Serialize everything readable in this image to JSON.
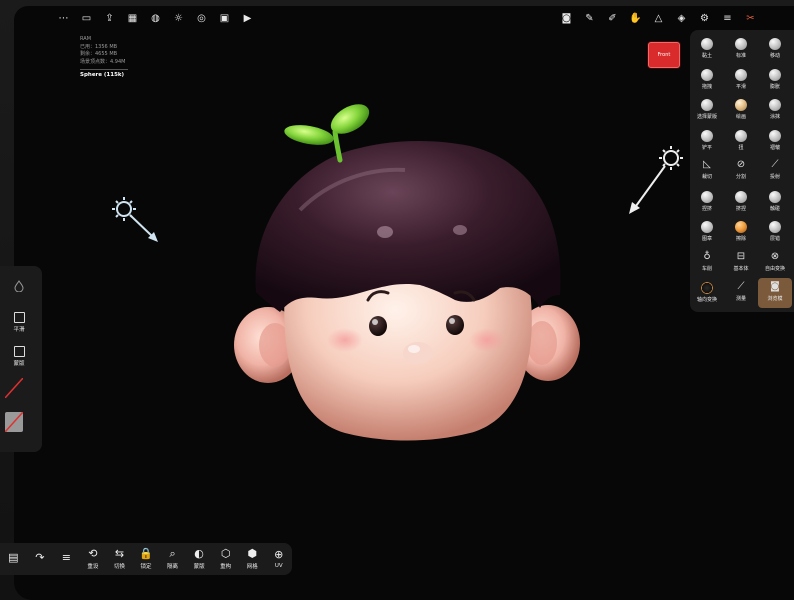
{
  "stats": {
    "ram_heading": "RAM",
    "line1": "已用：1356 MB",
    "line2": "剩余：4655 MB",
    "line3": "场景顶点数：4.94M",
    "object_name": "Sphere (115k)"
  },
  "front_button": "Front",
  "top_left_icons": [
    "scene-icon",
    "folder-icon",
    "share-icon",
    "grid-icon",
    "sphere-icon",
    "sun-icon",
    "target-icon",
    "image-icon",
    "video-icon"
  ],
  "top_right_icons": [
    "camera-icon",
    "brush-icon",
    "pen-icon",
    "hand-icon",
    "triangle-icon",
    "layers-icon",
    "settings-icon",
    "menu-icon",
    "tools-icon"
  ],
  "tools": [
    {
      "label": "黏土",
      "icon": "clay-icon"
    },
    {
      "label": "标准",
      "icon": "standard-icon"
    },
    {
      "label": "移动",
      "icon": "move-icon"
    },
    {
      "label": "拖拽",
      "icon": "drag-icon"
    },
    {
      "label": "平滑",
      "icon": "smooth-icon"
    },
    {
      "label": "膨胀",
      "icon": "inflate-icon"
    },
    {
      "label": "选择蒙版",
      "icon": "select-mask-icon"
    },
    {
      "label": "绘画",
      "icon": "paint-icon"
    },
    {
      "label": "涂抹",
      "icon": "smudge-icon"
    },
    {
      "label": "铲平",
      "icon": "flatten-icon"
    },
    {
      "label": "扭",
      "icon": "twist-icon"
    },
    {
      "label": "褶皱",
      "icon": "crease-icon"
    },
    {
      "label": "裁切",
      "icon": "trim-icon"
    },
    {
      "label": "分割",
      "icon": "split-icon"
    },
    {
      "label": "投射",
      "icon": "project-icon"
    },
    {
      "label": "捏挤",
      "icon": "pinch-icon"
    },
    {
      "label": "挤捏",
      "icon": "nudge-icon"
    },
    {
      "label": "触碰",
      "icon": "touch-icon"
    },
    {
      "label": "图章",
      "icon": "stamp-icon"
    },
    {
      "label": "擦除",
      "icon": "erase-icon"
    },
    {
      "label": "层错",
      "icon": "layer-icon"
    },
    {
      "label": "车削",
      "icon": "lathe-icon"
    },
    {
      "label": "基本体",
      "icon": "primitive-icon"
    },
    {
      "label": "自由变换",
      "icon": "free-transform-icon"
    },
    {
      "label": "轴向变换",
      "icon": "gizmo-icon"
    },
    {
      "label": "测量",
      "icon": "measure-icon"
    },
    {
      "label": "浏览模",
      "icon": "view-icon"
    }
  ],
  "left_panel": {
    "smooth_label": "平滑",
    "mask_label": "蒙版"
  },
  "bottom_bar": [
    {
      "label": "",
      "icon": "book-icon"
    },
    {
      "label": "",
      "icon": "redo-icon"
    },
    {
      "label": "",
      "icon": "menu-icon"
    },
    {
      "label": "重设",
      "icon": "reset-icon"
    },
    {
      "label": "切换",
      "icon": "toggle-icon"
    },
    {
      "label": "锁定",
      "icon": "lock-icon"
    },
    {
      "label": "隔离",
      "icon": "isolate-icon"
    },
    {
      "label": "蒙版",
      "icon": "mask-icon"
    },
    {
      "label": "重构",
      "icon": "remesh-icon"
    },
    {
      "label": "网格",
      "icon": "mesh-icon"
    },
    {
      "label": "UV",
      "icon": "uv-icon"
    }
  ],
  "colors": {
    "accent": "#d92b2b",
    "panel": "#1b1b1b",
    "hair": "#2a1420",
    "skin": "#f2c4b6",
    "sprout": "#7fd13a"
  }
}
